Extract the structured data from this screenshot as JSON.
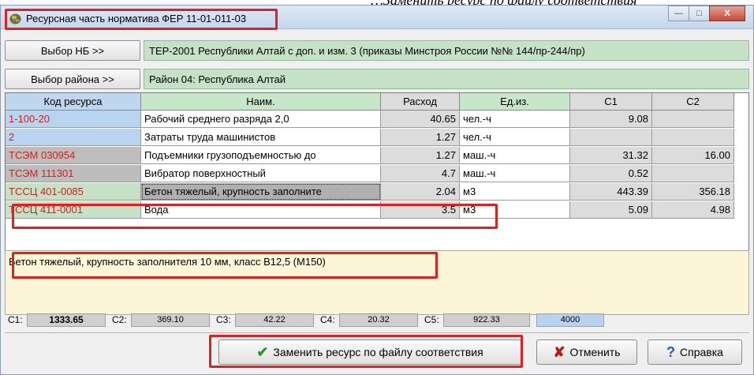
{
  "caption_fragment": "…Заменить ресурс по файлу соответствия",
  "window": {
    "title": "Ресурсная часть норматива ФЕР 11-01-011-03",
    "controls": {
      "minimize": "—",
      "maximize": "□",
      "close": "X"
    }
  },
  "selectors": {
    "nb_button": "Выбор НБ >>",
    "nb_value": "ТЕР-2001 Республики Алтай с доп. и изм. 3 (приказы Минстроя России №№ 144/пр-244/пр)",
    "region_button": "Выбор района >>",
    "region_value": "Район 04: Республика Алтай"
  },
  "table": {
    "headers": [
      "Код ресурса",
      "Наим.",
      "Расход",
      "Ед.из.",
      "С1",
      "С2"
    ],
    "rows": [
      {
        "code": "1-100-20",
        "name": "Рабочий среднего разряда 2,0",
        "rate": "40.65",
        "unit": "чел.-ч",
        "c1": "9.08",
        "c2": ""
      },
      {
        "code": "2",
        "name": "Затраты труда машинистов",
        "rate": "1.27",
        "unit": "чел.-ч",
        "c1": "",
        "c2": ""
      },
      {
        "code": "ТСЭМ 030954",
        "name": "Подъемники грузоподъемностью до",
        "rate": "1.27",
        "unit": "маш.-ч",
        "c1": "31.32",
        "c2": "16.00"
      },
      {
        "code": "ТСЭМ 111301",
        "name": "Вибратор поверхностный",
        "rate": "4.7",
        "unit": "маш.-ч",
        "c1": "0.52",
        "c2": ""
      },
      {
        "code": "ТССЦ 401-0085",
        "name": "Бетон тяжелый, крупность заполните",
        "rate": "2.04",
        "unit": "м3",
        "c1": "443.39",
        "c2": "356.18"
      },
      {
        "code": "ТССЦ 411-0001",
        "name": "Вода",
        "rate": "3.5",
        "unit": "м3",
        "c1": "5.09",
        "c2": "4.98"
      }
    ]
  },
  "description": "Бетон тяжелый, крупность заполнителя 10 мм, класс В12,5 (М150)",
  "totals": [
    {
      "label": "С1:",
      "value": "1333.65"
    },
    {
      "label": "С2:",
      "value": "369.10"
    },
    {
      "label": "С3:",
      "value": "42.22"
    },
    {
      "label": "С4:",
      "value": "20.32"
    },
    {
      "label": "С5:",
      "value": "922.33"
    }
  ],
  "totals_extra": "4000",
  "buttons": {
    "replace": "Заменить ресурс по файлу соответствия",
    "cancel": "Отменить",
    "help": "Справка"
  },
  "colors": {
    "highlight_red": "#e02020",
    "header_green": "#c8e6c9",
    "code_blue": "#b8d4f0",
    "code_grey": "#bdbdbd",
    "code_green": "#c6e2c6",
    "code_text_red": "#d42020"
  }
}
